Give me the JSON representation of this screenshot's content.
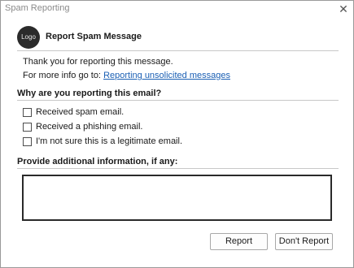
{
  "window": {
    "title": "Spam Reporting",
    "close_glyph": "✕"
  },
  "header": {
    "logo_text": "Logo",
    "title": "Report Spam Message"
  },
  "intro": {
    "line1": "Thank you for reporting this message.",
    "line2_prefix": "For more info go to:",
    "link_text": "Reporting unsolicited messages"
  },
  "reasons": {
    "title": "Why are you reporting this email?",
    "options": [
      {
        "label": "Received spam email.",
        "checked": false
      },
      {
        "label": "Received a phishing email.",
        "checked": false
      },
      {
        "label": "I'm not sure this is a legitimate email.",
        "checked": false
      }
    ]
  },
  "additional": {
    "title": "Provide additional information, if any:",
    "value": "",
    "placeholder": ""
  },
  "buttons": {
    "report": "Report",
    "dont_report": "Don't Report"
  },
  "colors": {
    "link": "#1a5fb4",
    "logo_bg": "#2b2b2b",
    "rule": "#c8c8c8"
  },
  "icons": {
    "close": "close-icon",
    "checkbox": "checkbox-icon"
  }
}
